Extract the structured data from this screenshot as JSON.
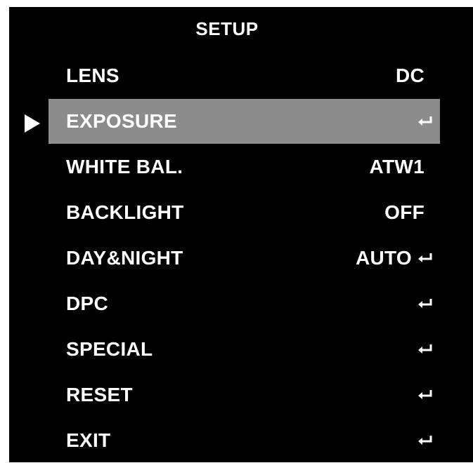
{
  "menu": {
    "title": "SETUP",
    "items": [
      {
        "label": "LENS",
        "value": "DC",
        "submenu": false
      },
      {
        "label": "EXPOSURE",
        "value": "",
        "submenu": true
      },
      {
        "label": "WHITE BAL.",
        "value": "ATW1",
        "submenu": false
      },
      {
        "label": "BACKLIGHT",
        "value": "OFF",
        "submenu": false
      },
      {
        "label": "DAY&NIGHT",
        "value": "AUTO",
        "submenu": true
      },
      {
        "label": "DPC",
        "value": "",
        "submenu": true
      },
      {
        "label": "SPECIAL",
        "value": "",
        "submenu": true
      },
      {
        "label": "RESET",
        "value": "",
        "submenu": true
      },
      {
        "label": "EXIT",
        "value": "",
        "submenu": true
      }
    ],
    "selected_index": 1
  },
  "icons": {
    "selector": "play-arrow-icon",
    "enter": "enter-return-icon"
  },
  "colors": {
    "background": "#000000",
    "text": "#ffffff",
    "highlight": "#8c8c8c"
  }
}
